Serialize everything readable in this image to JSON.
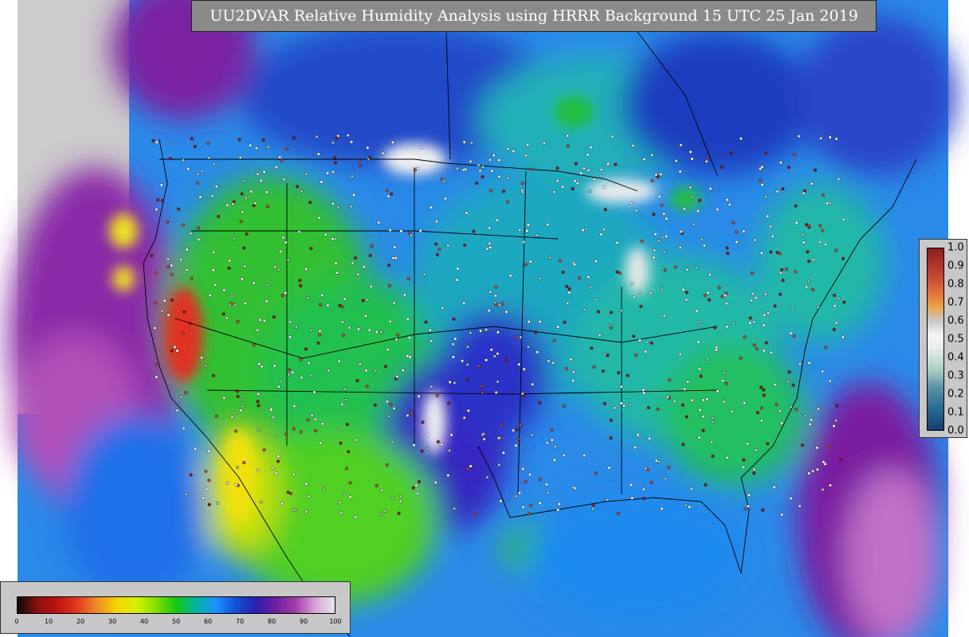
{
  "title": "UU2DVAR Relative Humidity Analysis using HRRR Background 15 UTC 25 Jan 2019",
  "colorbar_rh": {
    "ticks": [
      "0",
      "10",
      "20",
      "30",
      "40",
      "50",
      "60",
      "70",
      "80",
      "90",
      "100"
    ],
    "colors": [
      "#0a0a0a",
      "#8b1010",
      "#c01212",
      "#e03a1e",
      "#f08a28",
      "#f5d400",
      "#d8f000",
      "#80e000",
      "#14c814",
      "#00b4a0",
      "#1e90ff",
      "#1450d8",
      "#2820b0",
      "#6e1ea0",
      "#a03ca8",
      "#d8a0d8",
      "#e8e8e8"
    ]
  },
  "colorbar_obs": {
    "ticks": [
      "0.0",
      "0.1",
      "0.2",
      "0.3",
      "0.4",
      "0.5",
      "0.6",
      "0.7",
      "0.8",
      "0.9",
      "1.0"
    ]
  },
  "colors": {
    "land_dry": "#20c020",
    "land_moist": "#1aa8a8",
    "very_moist": "#2a32c8",
    "saturated": "#e0e0e0",
    "ocean": "#1e90ff",
    "missing": "#cccccc"
  }
}
